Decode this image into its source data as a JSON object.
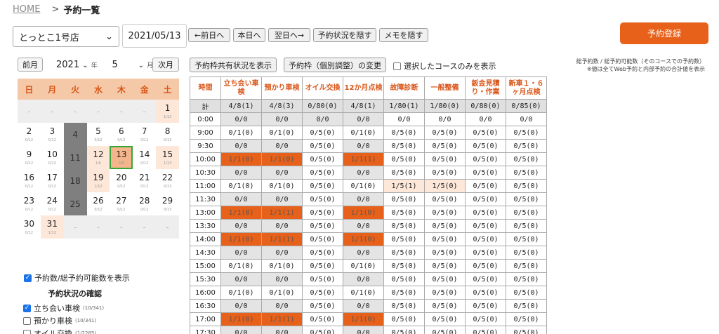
{
  "breadcrumb": {
    "home": "HOME",
    "sep": ">",
    "current": "予約一覧"
  },
  "toolbar": {
    "store": "とっとこ1号店",
    "date": "2021/05/13",
    "prev_day": "←前日へ",
    "today": "本日へ",
    "next_day": "翌日へ→",
    "hide_status": "予約状況を隠す",
    "hide_memo": "メモを隠す",
    "register": "予約登録"
  },
  "note": [
    "総予約数 / 総予約可能数（そのコースでの予約数）",
    "※値は全てWeb予約と内部予約の合計値を表示"
  ],
  "calendar": {
    "prev": "前月",
    "next": "次月",
    "year": "2021",
    "year_unit": "年",
    "month": "5",
    "month_unit": "月",
    "weekdays": [
      "日",
      "月",
      "火",
      "水",
      "木",
      "金",
      "土"
    ],
    "cells": [
      {
        "d": "-",
        "s": "",
        "t": "empty"
      },
      {
        "d": "-",
        "s": "",
        "t": "empty"
      },
      {
        "d": "-",
        "s": "",
        "t": "empty"
      },
      {
        "d": "-",
        "s": "",
        "t": "empty"
      },
      {
        "d": "-",
        "s": "",
        "t": "empty"
      },
      {
        "d": "-",
        "s": "",
        "t": "empty"
      },
      {
        "d": "1",
        "s": "1/13",
        "t": "sat"
      },
      {
        "d": "2",
        "s": "0/12",
        "t": ""
      },
      {
        "d": "3",
        "s": "0/12",
        "t": ""
      },
      {
        "d": "4",
        "s": "",
        "t": "closed"
      },
      {
        "d": "5",
        "s": "0/12",
        "t": ""
      },
      {
        "d": "6",
        "s": "0/12",
        "t": ""
      },
      {
        "d": "7",
        "s": "0/12",
        "t": ""
      },
      {
        "d": "8",
        "s": "0/13",
        "t": ""
      },
      {
        "d": "9",
        "s": "0/12",
        "t": ""
      },
      {
        "d": "10",
        "s": "0/12",
        "t": ""
      },
      {
        "d": "11",
        "s": "",
        "t": "closed"
      },
      {
        "d": "12",
        "s": "1/6",
        "t": "busy"
      },
      {
        "d": "13",
        "s": "4/8",
        "t": "sel"
      },
      {
        "d": "14",
        "s": "0/12",
        "t": ""
      },
      {
        "d": "15",
        "s": "1/13",
        "t": "sat"
      },
      {
        "d": "16",
        "s": "0/12",
        "t": ""
      },
      {
        "d": "17",
        "s": "0/12",
        "t": ""
      },
      {
        "d": "18",
        "s": "",
        "t": "closed"
      },
      {
        "d": "19",
        "s": "1/12",
        "t": "busy"
      },
      {
        "d": "20",
        "s": "0/12",
        "t": ""
      },
      {
        "d": "21",
        "s": "0/12",
        "t": ""
      },
      {
        "d": "22",
        "s": "0/13",
        "t": ""
      },
      {
        "d": "23",
        "s": "0/12",
        "t": ""
      },
      {
        "d": "24",
        "s": "0/12",
        "t": ""
      },
      {
        "d": "25",
        "s": "",
        "t": "closed"
      },
      {
        "d": "26",
        "s": "0/12",
        "t": ""
      },
      {
        "d": "27",
        "s": "0/12",
        "t": ""
      },
      {
        "d": "28",
        "s": "0/12",
        "t": ""
      },
      {
        "d": "29",
        "s": "0/13",
        "t": ""
      },
      {
        "d": "30",
        "s": "0/12",
        "t": ""
      },
      {
        "d": "31",
        "s": "1/12",
        "t": "busy"
      },
      {
        "d": "-",
        "s": "",
        "t": "empty"
      },
      {
        "d": "-",
        "s": "",
        "t": "empty"
      },
      {
        "d": "-",
        "s": "",
        "t": "empty"
      },
      {
        "d": "-",
        "s": "",
        "t": "empty"
      },
      {
        "d": "-",
        "s": "",
        "t": "empty"
      }
    ],
    "show_counts_label": "予約数/総予約可能数を表示",
    "status_title": "予約状況の確認",
    "status_items": [
      {
        "label": "立ち会い車検",
        "count": "(10/341)",
        "checked": true
      },
      {
        "label": "預かり車検",
        "count": "(10/341)",
        "checked": false
      },
      {
        "label": "オイル交換",
        "count": "(1/2285)",
        "checked": false
      }
    ]
  },
  "table_tools": {
    "share_btn": "予約枠共有状況を表示",
    "change_btn": "予約枠（個別調整）の変更",
    "only_selected": "選択したコースのみを表示"
  },
  "table": {
    "headers": [
      "時間",
      "立ち会い車検",
      "預かり車検",
      "オイル交換",
      "12か月点検",
      "故障診断",
      "一般整備",
      "鈑金見積り・作業",
      "新車１・６ヶ月点検"
    ],
    "rows": [
      {
        "time": "計",
        "cells": [
          "4/8(1)",
          "4/8(3)",
          "0/80(0)",
          "4/8(1)",
          "1/80(1)",
          "1/80(0)",
          "0/80(0)",
          "0/85(0)"
        ],
        "cls": "total"
      },
      {
        "time": "0:00",
        "cells": [
          "0/0",
          "0/0",
          "0/0",
          "0/0",
          "0/0",
          "0/0",
          "0/0",
          "0/0"
        ],
        "m": [
          "z",
          "z",
          "z",
          "z",
          "",
          "",
          "",
          ""
        ]
      },
      {
        "time": "9:00",
        "cells": [
          "0/1(0)",
          "0/1(0)",
          "0/5(0)",
          "0/1(0)",
          "0/5(0)",
          "0/5(0)",
          "0/5(0)",
          "0/5(0)"
        ],
        "m": [
          "",
          "",
          "",
          "",
          "",
          "",
          "",
          ""
        ]
      },
      {
        "time": "9:30",
        "cells": [
          "0/0",
          "0/0",
          "0/5(0)",
          "0/0",
          "0/5(0)",
          "0/5(0)",
          "0/5(0)",
          "0/5(0)"
        ],
        "m": [
          "z",
          "z",
          "",
          "z",
          "",
          "",
          "",
          ""
        ]
      },
      {
        "time": "10:00",
        "cells": [
          "1/1(0)",
          "1/1(0)",
          "0/5(0)",
          "1/1(1)",
          "0/5(0)",
          "0/5(0)",
          "0/5(0)",
          "0/5(0)"
        ],
        "m": [
          "full",
          "full",
          "",
          "full",
          "",
          "",
          "",
          ""
        ]
      },
      {
        "time": "10:30",
        "cells": [
          "0/0",
          "0/0",
          "0/5(0)",
          "0/0",
          "0/5(0)",
          "0/5(0)",
          "0/5(0)",
          "0/5(0)"
        ],
        "m": [
          "z",
          "z",
          "",
          "z",
          "",
          "",
          "",
          ""
        ]
      },
      {
        "time": "11:00",
        "cells": [
          "0/1(0)",
          "0/1(0)",
          "0/5(0)",
          "0/1(0)",
          "1/5(1)",
          "1/5(0)",
          "0/5(0)",
          "0/5(0)"
        ],
        "m": [
          "",
          "",
          "",
          "",
          "part",
          "part",
          "",
          ""
        ]
      },
      {
        "time": "11:30",
        "cells": [
          "0/0",
          "0/0",
          "0/5(0)",
          "0/0",
          "0/5(0)",
          "0/5(0)",
          "0/5(0)",
          "0/5(0)"
        ],
        "m": [
          "z",
          "z",
          "",
          "z",
          "",
          "",
          "",
          ""
        ]
      },
      {
        "time": "13:00",
        "cells": [
          "1/1(0)",
          "1/1(1)",
          "0/5(0)",
          "1/1(0)",
          "0/5(0)",
          "0/5(0)",
          "0/5(0)",
          "0/5(0)"
        ],
        "m": [
          "full",
          "full",
          "",
          "full",
          "",
          "",
          "",
          ""
        ]
      },
      {
        "time": "13:30",
        "cells": [
          "0/0",
          "0/0",
          "0/5(0)",
          "0/0",
          "0/5(0)",
          "0/5(0)",
          "0/5(0)",
          "0/5(0)"
        ],
        "m": [
          "z",
          "z",
          "",
          "z",
          "",
          "",
          "",
          ""
        ]
      },
      {
        "time": "14:00",
        "cells": [
          "1/1(0)",
          "1/1(1)",
          "0/5(0)",
          "1/1(0)",
          "0/5(0)",
          "0/5(0)",
          "0/5(0)",
          "0/5(0)"
        ],
        "m": [
          "full",
          "full",
          "",
          "full",
          "",
          "",
          "",
          ""
        ]
      },
      {
        "time": "14:30",
        "cells": [
          "0/0",
          "0/0",
          "0/5(0)",
          "0/0",
          "0/5(0)",
          "0/5(0)",
          "0/5(0)",
          "0/5(0)"
        ],
        "m": [
          "z",
          "z",
          "",
          "z",
          "",
          "",
          "",
          ""
        ]
      },
      {
        "time": "15:00",
        "cells": [
          "0/1(0)",
          "0/1(0)",
          "0/5(0)",
          "0/1(0)",
          "0/5(0)",
          "0/5(0)",
          "0/5(0)",
          "0/5(0)"
        ],
        "m": [
          "",
          "",
          "",
          "",
          "",
          "",
          "",
          ""
        ]
      },
      {
        "time": "15:30",
        "cells": [
          "0/0",
          "0/0",
          "0/5(0)",
          "0/0",
          "0/5(0)",
          "0/5(0)",
          "0/5(0)",
          "0/5(0)"
        ],
        "m": [
          "z",
          "z",
          "",
          "z",
          "",
          "",
          "",
          ""
        ]
      },
      {
        "time": "16:00",
        "cells": [
          "0/1(0)",
          "0/1(0)",
          "0/5(0)",
          "0/1(0)",
          "0/5(0)",
          "0/5(0)",
          "0/5(0)",
          "0/5(0)"
        ],
        "m": [
          "",
          "",
          "",
          "",
          "",
          "",
          "",
          ""
        ]
      },
      {
        "time": "16:30",
        "cells": [
          "0/0",
          "0/0",
          "0/5(0)",
          "0/0",
          "0/5(0)",
          "0/5(0)",
          "0/5(0)",
          "0/5(0)"
        ],
        "m": [
          "z",
          "z",
          "",
          "z",
          "",
          "",
          "",
          ""
        ]
      },
      {
        "time": "17:00",
        "cells": [
          "1/1(0)",
          "1/1(1)",
          "0/5(0)",
          "1/1(0)",
          "0/5(0)",
          "0/5(0)",
          "0/5(0)",
          "0/5(0)"
        ],
        "m": [
          "full",
          "full",
          "",
          "full",
          "",
          "",
          "",
          ""
        ]
      },
      {
        "time": "17:30",
        "cells": [
          "0/0",
          "0/0",
          "0/5(0)",
          "0/0",
          "0/5(0)",
          "0/5(0)",
          "0/5(0)",
          "0/5(0)"
        ],
        "m": [
          "z",
          "z",
          "",
          "z",
          "",
          "",
          "",
          ""
        ]
      }
    ]
  },
  "colors": {
    "accent": "#e8611a",
    "header_text": "#d9561a",
    "light": "#fde7d9",
    "closed": "#7f7f7f"
  }
}
